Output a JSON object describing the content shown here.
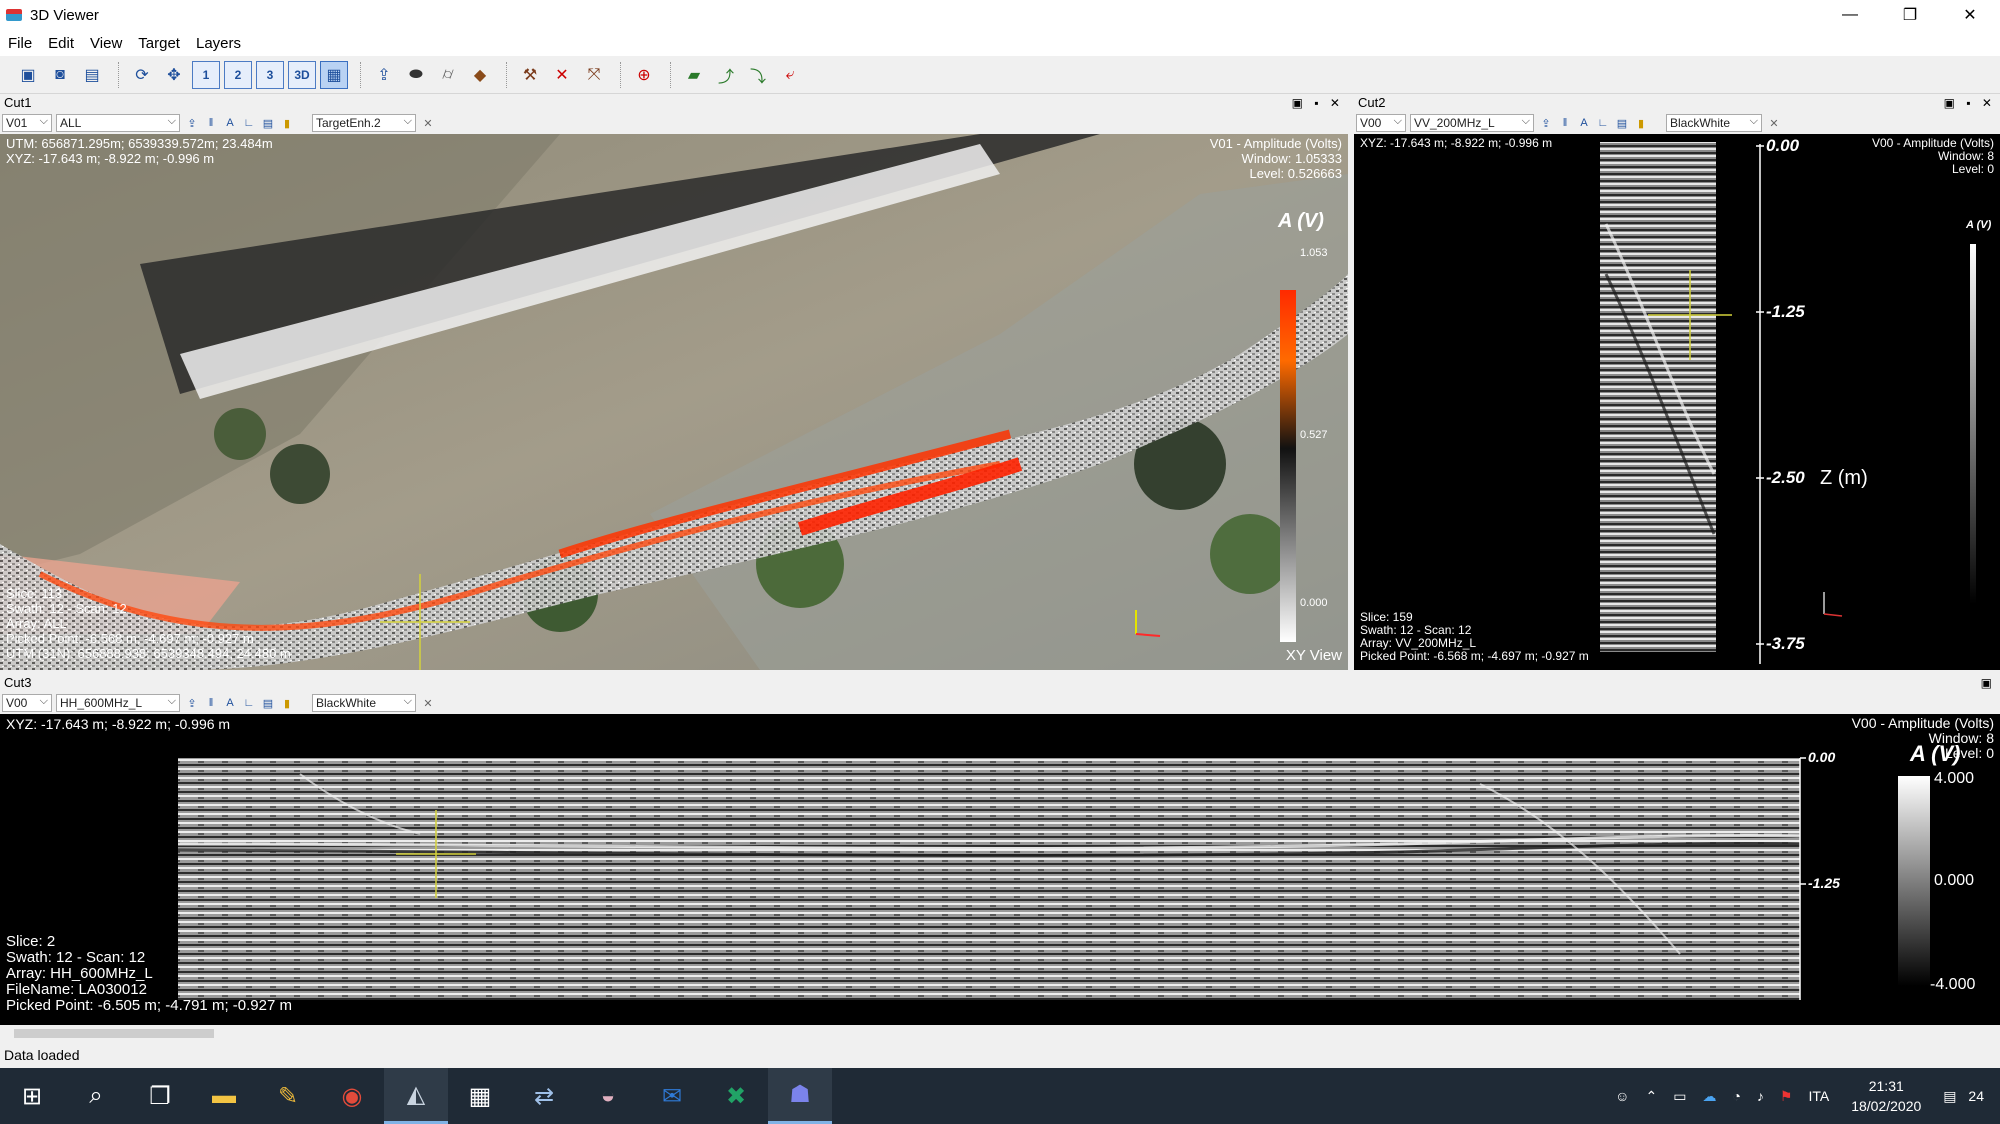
{
  "window": {
    "title": "3D Viewer",
    "minimize": "—",
    "maximize": "❐",
    "close": "✕"
  },
  "menu": [
    "File",
    "Edit",
    "View",
    "Target",
    "Layers"
  ],
  "cut1": {
    "name": "Cut1",
    "dropdowns": [
      "V01",
      "ALL",
      "TargetEnh.2"
    ],
    "utm": "UTM: 656871.295m; 6539339.572m; 23.484m",
    "xyz": "XYZ: -17.643 m; -8.922 m; -0.996 m",
    "amp_title": "V01 - Amplitude (Volts)",
    "window": "Window: 1.05333",
    "level": "Level: 0.526663",
    "colorbar_title": "A (V)",
    "colorbar_max": "1.053",
    "colorbar_mid": "0.527",
    "colorbar_min": "0.000",
    "slice": "Slice: 113",
    "swath": "Swath: 12 - Scan: 12",
    "array": "Array: ALL",
    "picked": "Picked Point: -6.568 m; -4.697 m; -0.927 m",
    "utm2": "UTM (31N): 656888.938; 6539348.494; 24.480 m",
    "view_label": "XY View"
  },
  "cut2": {
    "name": "Cut2",
    "dropdowns": [
      "V00",
      "VV_200MHz_L",
      "BlackWhite"
    ],
    "xyz": "XYZ: -17.643 m; -8.922 m; -0.996 m",
    "amp_title": "V00 - Amplitude (Volts)",
    "window": "Window: 8",
    "level": "Level: 0",
    "colorbar_title": "A (V)",
    "z_ticks": [
      "0.00",
      "-1.25",
      "-2.50",
      "-3.75"
    ],
    "z_label": "Z (m)",
    "slice": "Slice: 159",
    "swath": "Swath: 12 - Scan: 12",
    "array": "Array: VV_200MHz_L",
    "picked": "Picked Point: -6.568 m; -4.697 m; -0.927 m"
  },
  "cut3": {
    "name": "Cut3",
    "dropdowns": [
      "V00",
      "HH_600MHz_L",
      "BlackWhite"
    ],
    "xyz": "XYZ: -17.643 m; -8.922 m; -0.996 m",
    "amp_title": "V00 - Amplitude (Volts)",
    "window": "Window: 8",
    "level": "Level: 0",
    "colorbar_title": "A (V)",
    "colorbar_max": "4.000",
    "colorbar_mid": "0.000",
    "colorbar_min": "-4.000",
    "z_ticks": [
      "0.00",
      "-1.25"
    ],
    "slice": "Slice: 2",
    "swath": "Swath: 12 - Scan: 12",
    "array": "Array: HH_600MHz_L",
    "filename": "FileName: LA030012",
    "picked": "Picked Point: -6.505 m; -4.791 m; -0.927 m"
  },
  "status": "Data loaded",
  "tray": {
    "lang": "ITA",
    "time": "21:31",
    "date": "18/02/2020",
    "notifications": "24"
  }
}
